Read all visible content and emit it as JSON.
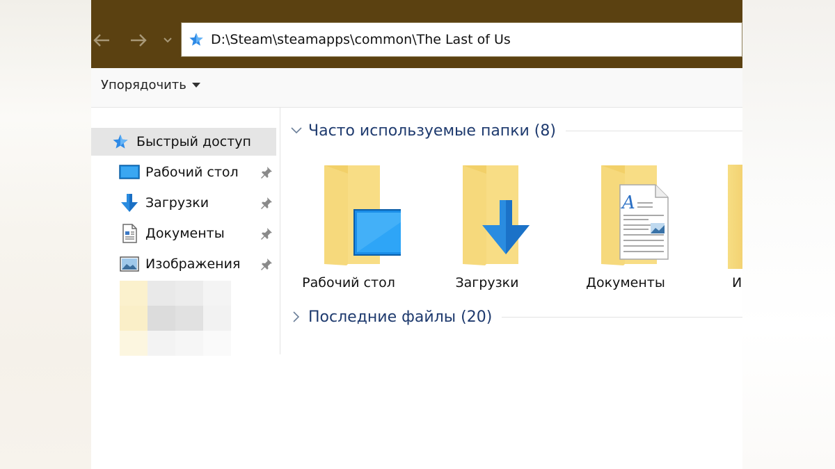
{
  "address": {
    "path": "D:\\Steam\\steamapps\\common\\The Last of Us"
  },
  "ribbon": {
    "sort_label": "Упорядочить"
  },
  "sidebar": {
    "quick_access": "Быстрый доступ",
    "items": [
      {
        "label": "Рабочий стол",
        "icon": "desktop-icon"
      },
      {
        "label": "Загрузки",
        "icon": "download-icon"
      },
      {
        "label": "Документы",
        "icon": "document-icon"
      },
      {
        "label": "Изображения",
        "icon": "pictures-icon"
      }
    ]
  },
  "content": {
    "frequent_title": "Часто используемые папки (8)",
    "recent_title": "Последние файлы (20)",
    "folders": [
      {
        "label": "Рабочий стол"
      },
      {
        "label": "Загрузки"
      },
      {
        "label": "Документы"
      }
    ],
    "partial_label": "И"
  },
  "colors": {
    "titlebar": "#5b4111",
    "group_title": "#1e3a6e",
    "selected_item": "#e5e5e5",
    "folder": "#f7d97a",
    "accent_blue": "#2a8ce0"
  }
}
